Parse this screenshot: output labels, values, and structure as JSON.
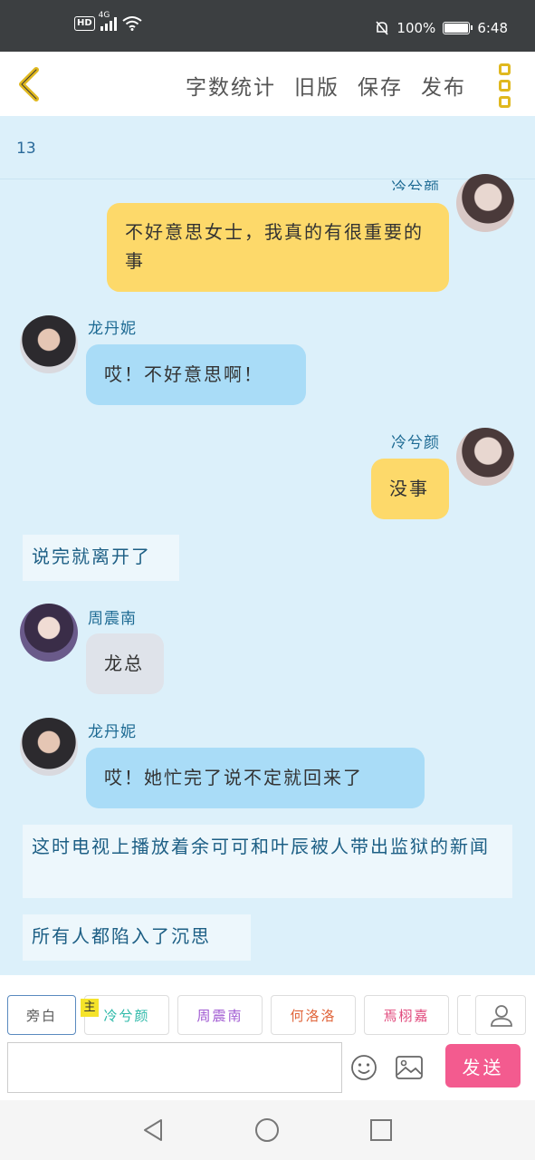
{
  "status_bar": {
    "hd": "HD",
    "network": "4G",
    "battery": "100%",
    "time": "6:48"
  },
  "topbar": {
    "actions": [
      "字数统计",
      "旧版",
      "保存",
      "发布"
    ]
  },
  "word_count": "13",
  "messages": [
    {
      "type": "right",
      "speaker": "冷兮颜",
      "text": "不好意思女士，我真的有很重要的事",
      "color": "yellow"
    },
    {
      "type": "left",
      "speaker": "龙丹妮",
      "text": "哎！不好意思啊！",
      "color": "blue"
    },
    {
      "type": "right",
      "speaker": "冷兮颜",
      "text": "没事",
      "color": "yellow"
    },
    {
      "type": "narration",
      "text": "说完就离开了"
    },
    {
      "type": "left",
      "speaker": "周震南",
      "text": "龙总",
      "color": "grey"
    },
    {
      "type": "left",
      "speaker": "龙丹妮",
      "text": "哎！她忙完了说不定就回来了",
      "color": "blue"
    },
    {
      "type": "narration",
      "text": "这时电视上播放着余可可和叶辰被人带出监狱的新闻"
    },
    {
      "type": "narration",
      "text": "所有人都陷入了沉思"
    }
  ],
  "composer": {
    "main_tag": "主",
    "roles": [
      {
        "label": "旁白",
        "color": "#5a5a5a",
        "active": true
      },
      {
        "label": "冷兮颜",
        "color": "#2bb8a8",
        "active": false
      },
      {
        "label": "周震南",
        "color": "#a05ad2",
        "active": false
      },
      {
        "label": "何洛洛",
        "color": "#e0643a",
        "active": false
      },
      {
        "label": "焉栩嘉",
        "color": "#e0467a",
        "active": false
      }
    ],
    "input_value": "",
    "send_label": "发送"
  },
  "colors": {
    "accent_yellow": "#e0b81e",
    "send_pink": "#f35b8f",
    "chat_bg": "#dcf0fa"
  }
}
